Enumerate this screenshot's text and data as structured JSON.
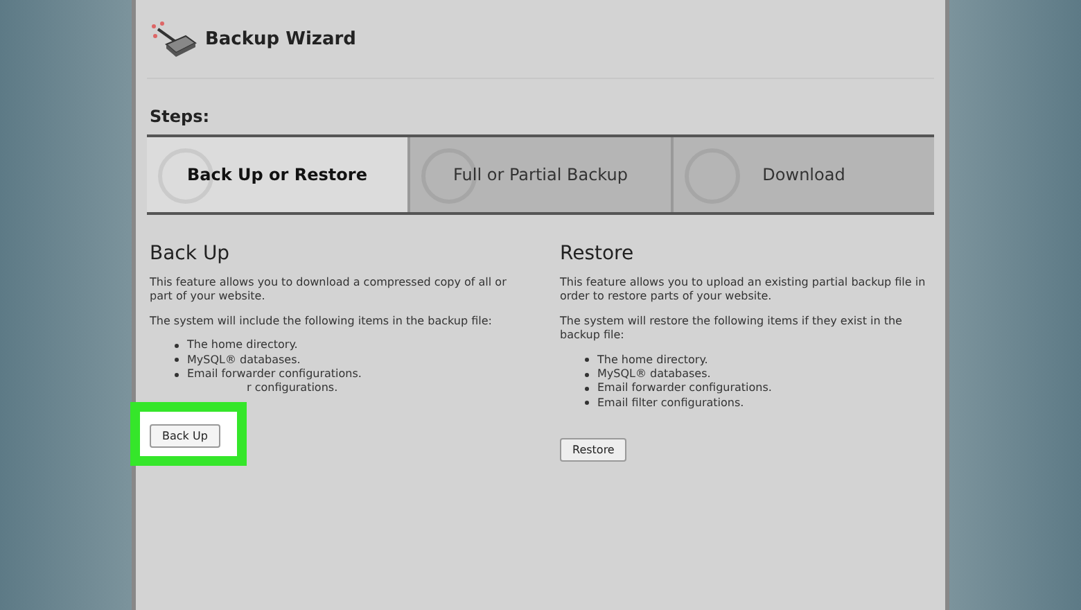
{
  "header": {
    "title": "Backup Wizard"
  },
  "steps_label": "Steps:",
  "steps": [
    {
      "label": "Back Up or Restore",
      "selected": true
    },
    {
      "label": "Full or Partial Backup",
      "selected": false
    },
    {
      "label": "Download",
      "selected": false
    }
  ],
  "sections": [
    {
      "title": "Back Up",
      "description": "This feature allows you to download a compressed copy of all or part of your website.",
      "intro": "The system will include the following items in the backup file:",
      "items": [
        {
          "text": "The home directory.",
          "kind": "bullet"
        },
        {
          "text": "MySQL® databases.",
          "kind": "bullet"
        },
        {
          "text": "Email forwarder configurations.",
          "kind": "bullet"
        },
        {
          "text": "r configurations.",
          "kind": "partial"
        }
      ],
      "button": "Back Up",
      "highlighted": true
    },
    {
      "title": "Restore",
      "description": "This feature allows you to upload an existing partial backup file in order to restore parts of your website.",
      "intro": "The system will restore the following items if they exist in the backup file:",
      "items": [
        {
          "text": "The home directory.",
          "kind": "bullet"
        },
        {
          "text": "MySQL® databases.",
          "kind": "bullet"
        },
        {
          "text": "Email forwarder configurations.",
          "kind": "bullet"
        },
        {
          "text": "Email filter configurations.",
          "kind": "bullet"
        }
      ],
      "button": "Restore",
      "highlighted": false
    }
  ]
}
